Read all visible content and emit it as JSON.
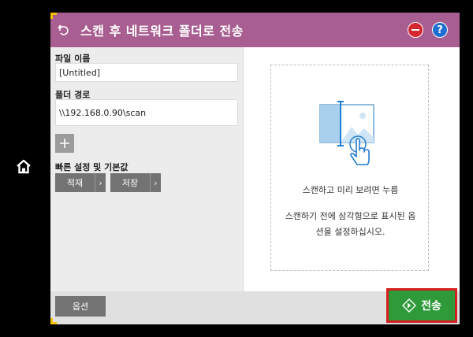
{
  "header": {
    "title": "스캔 후 네트워크 폴더로 전송"
  },
  "form": {
    "file_name_label": "파일 이름",
    "file_name_value": "[Untitled]",
    "folder_path_label": "폴더 경로",
    "folder_path_value": "\\\\192.168.0.90\\scan"
  },
  "quick_sets": {
    "label": "빠른 설정 및 기본값",
    "buttons": [
      {
        "label": "적재"
      },
      {
        "label": "저장"
      }
    ]
  },
  "preview": {
    "caption": "스캔하고 미리 보려면 누름",
    "note": "스캔하기 전에 삼각형으로 표시된 옵션을 설정하십시오."
  },
  "footer": {
    "options_label": "옵션",
    "send_label": "전송"
  },
  "colors": {
    "titlebar": "#a85e90",
    "send_button": "#2e9a3a",
    "send_highlight": "#d61f1f",
    "corner_marks": "#f2c200",
    "help_icon": "#1f6fd0",
    "minus_icon": "#d6262f"
  },
  "icons": [
    "home-icon",
    "back-icon",
    "minus-icon",
    "help-icon",
    "plus-icon",
    "chevron-right-icon",
    "chevron-left-icon",
    "scan-preview-icon",
    "start-icon"
  ]
}
